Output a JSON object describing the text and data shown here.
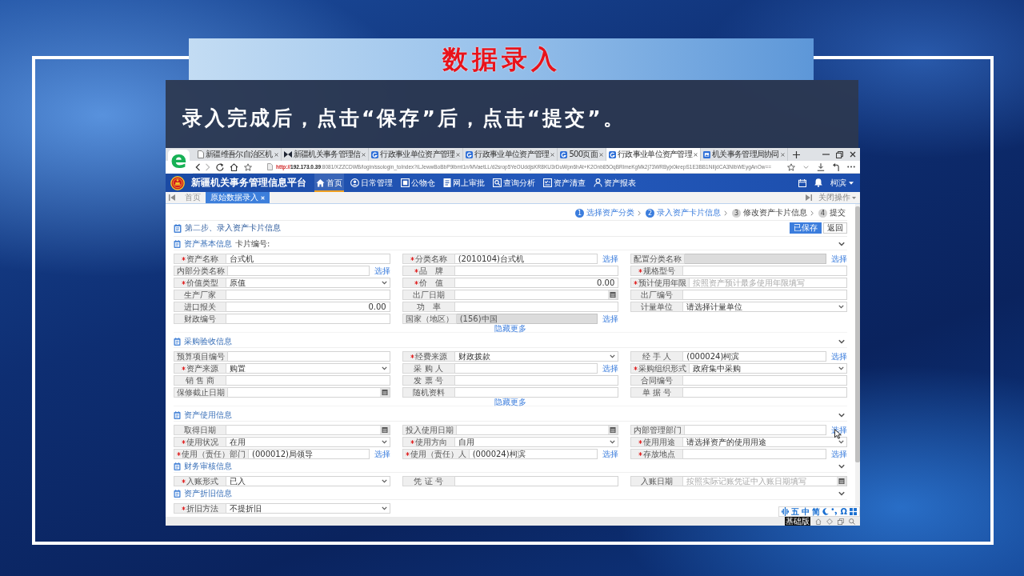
{
  "slide": {
    "title": "数据录入",
    "instruction": "录入完成后，点击“保存”后，点击“提交”。"
  },
  "browser": {
    "logo": "e",
    "tabs": [
      {
        "title": "新疆维吾尔自治区机",
        "selected": false
      },
      {
        "title": "新疆机关事务管理信",
        "selected": false
      },
      {
        "title": "行政事业单位资产管理",
        "selected": false
      },
      {
        "title": "行政事业单位资产管理",
        "selected": false
      },
      {
        "title": "500页面",
        "selected": false
      },
      {
        "title": "行政事业单位资产管理",
        "selected": true
      },
      {
        "title": "机关事务管理局协同",
        "selected": false
      }
    ],
    "url": {
      "scheme": "http://",
      "host": "192.173.0.39",
      "path": ":8081/XZZCDWB/login/ssologin_toIndex?iLJewwBoBbP9lbmt1n/MVaetLL/d2srop5YeOUddjsKR8KU3rDuWpn6hAt+K2Onb85OqBRlmeKgMk2j73WRByjx0krepS1E3BB1NiIjdCA3NIbWEygAnOw=="
    }
  },
  "app": {
    "title": "新疆机关事务管理信息平台",
    "nav": [
      {
        "label": "首页",
        "selected": true
      },
      {
        "label": "日常管理",
        "selected": false
      },
      {
        "label": "公物仓",
        "selected": false
      },
      {
        "label": "网上审批",
        "selected": false
      },
      {
        "label": "查询分析",
        "selected": false
      },
      {
        "label": "资产清查",
        "selected": false
      },
      {
        "label": "资产报表",
        "selected": false
      }
    ],
    "user": "柯滨",
    "page_tabs": [
      {
        "label": "首页",
        "selected": false,
        "closable": false
      },
      {
        "label": "原始数据录入",
        "selected": true,
        "closable": true
      }
    ],
    "close_menu": "关闭操作"
  },
  "form": {
    "steps": [
      {
        "number": "1",
        "label": "选择资产分类",
        "active": true
      },
      {
        "number": "2",
        "label": "录入资产卡片信息",
        "active": true
      },
      {
        "number": "3",
        "label": "修改资产卡片信息",
        "active": false
      },
      {
        "number": "4",
        "label": "提交",
        "active": false
      }
    ],
    "heading": "第二步、录入资产卡片信息",
    "buttons": [
      {
        "label": "已保存",
        "kind": "primary"
      },
      {
        "label": "返回",
        "kind": "default"
      }
    ],
    "sections": [
      {
        "title": "资产基本信息",
        "note": "卡片编号:",
        "expanded": true,
        "toggle": "隐藏更多",
        "fields": [
          {
            "label": "资产名称",
            "required": true,
            "kind": "text",
            "disabled": false,
            "value": "台式机"
          },
          {
            "label": "分类名称",
            "required": true,
            "kind": "text",
            "disabled": false,
            "value": "(2010104)台式机",
            "link": "选择"
          },
          {
            "label": "配置分类名称",
            "required": false,
            "kind": "text",
            "disabled": true,
            "link": "选择"
          },
          {
            "label": "内部分类名称",
            "required": false,
            "kind": "text",
            "disabled": false,
            "link": "选择"
          },
          {
            "label": "品　牌",
            "required": true,
            "kind": "text",
            "disabled": false
          },
          {
            "label": "规格型号",
            "required": true,
            "kind": "text",
            "disabled": false
          },
          {
            "label": "价值类型",
            "required": true,
            "kind": "select",
            "disabled": false,
            "value": "原值"
          },
          {
            "label": "价　值",
            "required": true,
            "kind": "number",
            "disabled": false,
            "value": "0.00"
          },
          {
            "label": "预计使用年限",
            "required": true,
            "kind": "text",
            "disabled": false,
            "placeholder": "按照资产预计最多使用年限填写"
          },
          {
            "label": "生产厂家",
            "required": false,
            "kind": "text",
            "disabled": false
          },
          {
            "label": "出厂日期",
            "required": false,
            "kind": "date",
            "disabled": false
          },
          {
            "label": "出厂编号",
            "required": false,
            "kind": "text",
            "disabled": false
          },
          {
            "label": "进口报关",
            "required": false,
            "kind": "number",
            "disabled": false,
            "value": "0.00"
          },
          {
            "label": "功　率",
            "required": false,
            "kind": "text",
            "disabled": false
          },
          {
            "label": "计量单位",
            "required": false,
            "kind": "select",
            "disabled": false,
            "value": "请选择计量单位"
          },
          {
            "label": "财政编号",
            "required": false,
            "kind": "text",
            "disabled": false
          },
          {
            "label": "国家（地区）",
            "required": false,
            "kind": "text",
            "disabled": true,
            "value": "(156)中国",
            "link": "选择"
          }
        ]
      },
      {
        "title": "采购验收信息",
        "expanded": true,
        "toggle": "隐藏更多",
        "fields": [
          {
            "label": "预算项目编号",
            "required": false,
            "kind": "text",
            "disabled": false
          },
          {
            "label": "经费来源",
            "required": true,
            "kind": "select",
            "disabled": false,
            "value": "财政拨款"
          },
          {
            "label": "经 手 人",
            "required": false,
            "kind": "text",
            "disabled": false,
            "value": "(000024)柯滨",
            "link": "选择"
          },
          {
            "label": "资产来源",
            "required": true,
            "kind": "select",
            "disabled": false,
            "value": "购置"
          },
          {
            "label": "采 购 人",
            "required": false,
            "kind": "text",
            "disabled": false,
            "link": "选择"
          },
          {
            "label": "采购组织形式",
            "required": true,
            "kind": "select",
            "disabled": false,
            "value": "政府集中采购"
          },
          {
            "label": "销 售 商",
            "required": false,
            "kind": "text",
            "disabled": false
          },
          {
            "label": "发 票 号",
            "required": false,
            "kind": "text",
            "disabled": false
          },
          {
            "label": "合同编号",
            "required": false,
            "kind": "text",
            "disabled": false
          },
          {
            "label": "保修截止日期",
            "required": false,
            "kind": "date",
            "disabled": false
          },
          {
            "label": "随机资料",
            "required": false,
            "kind": "text",
            "disabled": false
          },
          {
            "label": "单 据 号",
            "required": false,
            "kind": "text",
            "disabled": false
          }
        ]
      },
      {
        "title": "资产使用信息",
        "expanded": true,
        "fields": [
          {
            "label": "取得日期",
            "required": false,
            "kind": "date",
            "disabled": false
          },
          {
            "label": "投入使用日期",
            "required": false,
            "kind": "date",
            "disabled": false
          },
          {
            "label": "内部管理部门",
            "required": false,
            "kind": "text",
            "disabled": false,
            "link": "选择"
          },
          {
            "label": "使用状况",
            "required": true,
            "kind": "select",
            "disabled": false,
            "value": "在用"
          },
          {
            "label": "使用方向",
            "required": true,
            "kind": "select",
            "disabled": false,
            "value": "自用"
          },
          {
            "label": "使用用途",
            "required": true,
            "kind": "select",
            "disabled": false,
            "value": "请选择资产的使用用途"
          },
          {
            "label": "使用（责任）部门",
            "required": true,
            "kind": "text",
            "disabled": false,
            "value": "(000012)局领导",
            "link": "选择"
          },
          {
            "label": "使用（责任）人",
            "required": true,
            "kind": "text",
            "disabled": false,
            "value": "(000024)柯滨",
            "link": "选择"
          },
          {
            "label": "存放地点",
            "required": true,
            "kind": "text",
            "disabled": false,
            "link": "选择"
          }
        ]
      },
      {
        "title": "财务审核信息",
        "expanded": true,
        "fields": [
          {
            "label": "入账形式",
            "required": true,
            "kind": "select",
            "disabled": false,
            "value": "已入"
          },
          {
            "label": "凭 证 号",
            "required": false,
            "kind": "text",
            "disabled": false
          },
          {
            "label": "入账日期",
            "required": false,
            "kind": "date",
            "disabled": false,
            "placeholder": "按照实际记账凭证中入账日期填写"
          }
        ]
      },
      {
        "title": "资产折旧信息",
        "expanded": true,
        "fields": [
          {
            "label": "折旧方法",
            "required": true,
            "kind": "select",
            "disabled": false,
            "value": "不提折旧"
          }
        ]
      }
    ]
  },
  "ime": {
    "keys": [
      "五",
      "中",
      "简"
    ],
    "symbol": "Ω",
    "edition": "基础版"
  }
}
